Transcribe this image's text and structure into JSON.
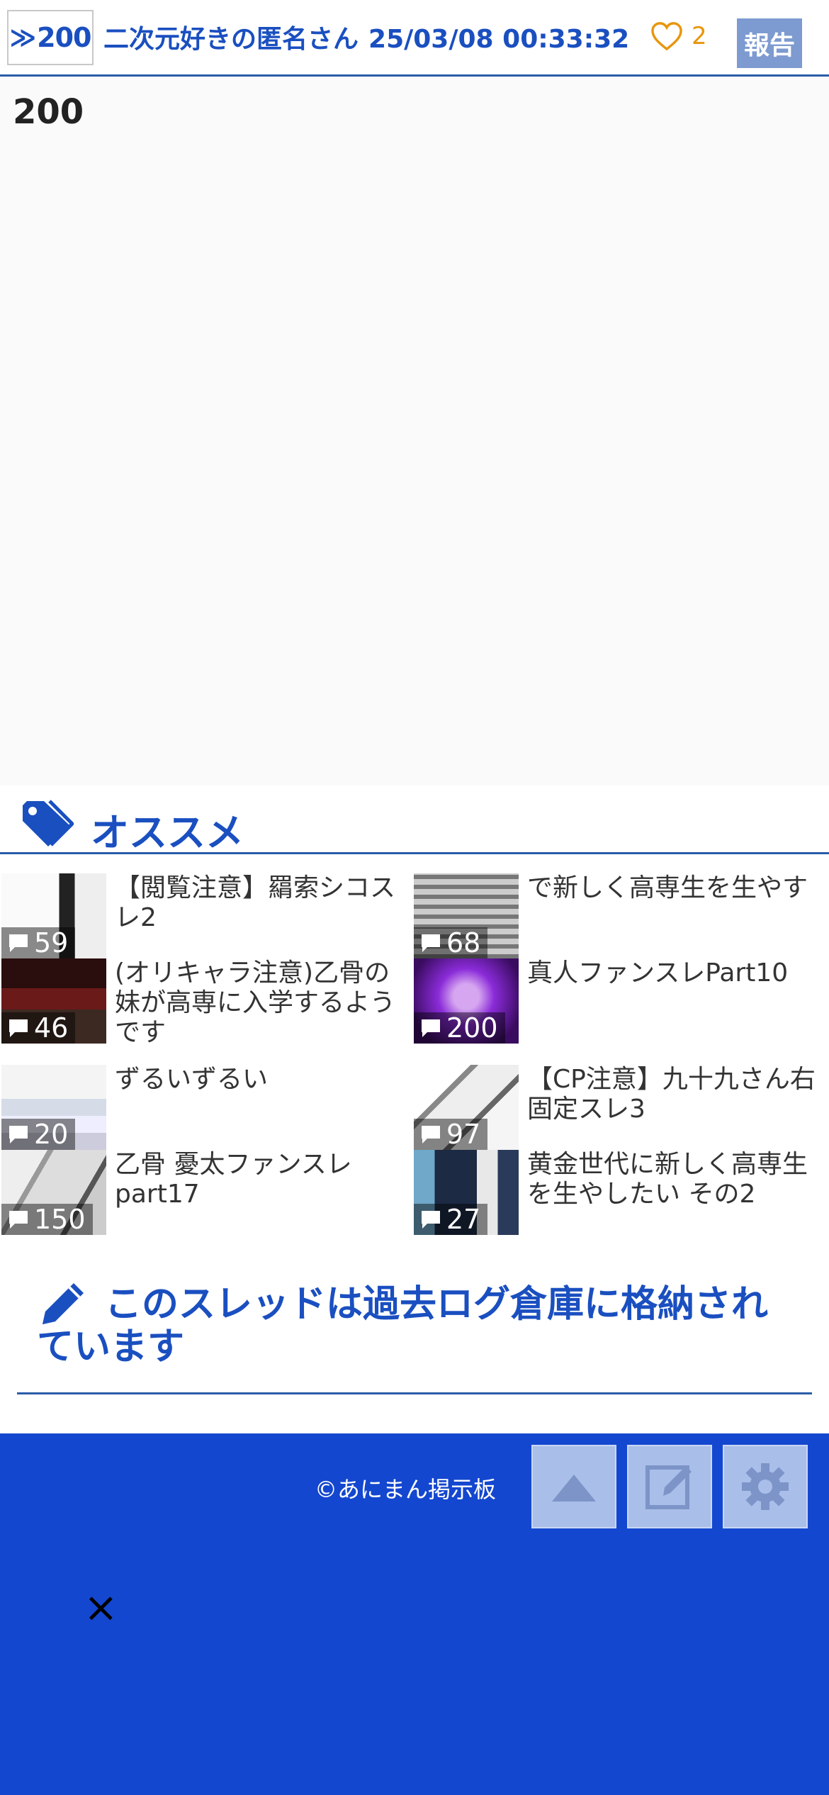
{
  "post": {
    "resno_label": "200",
    "poster_name": "二次元好きの匿名さん",
    "timestamp": "25/03/08 00:33:32",
    "likes": "2",
    "report_label": "報告",
    "body": "200"
  },
  "recommend": {
    "title": "オススメ",
    "items": [
      {
        "title": "【閲覧注意】羂索シコスレ2",
        "count": "59"
      },
      {
        "title": "で新しく高専生を生やす",
        "count": "68"
      },
      {
        "title": "(オリキャラ注意)乙骨の妹が高専に入学するようです",
        "count": "46"
      },
      {
        "title": "真人ファンスレPart10",
        "count": "200"
      },
      {
        "title": "ずるいずるい",
        "count": "20"
      },
      {
        "title": "【CP注意】九十九さん右固定スレ3",
        "count": "97"
      },
      {
        "title": "乙骨 憂太ファンスレpart17",
        "count": "150"
      },
      {
        "title": "黄金世代に新しく高専生を生やしたい その2",
        "count": "27"
      }
    ]
  },
  "archive_notice": "このスレッドは過去ログ倉庫に格納されています",
  "footer": {
    "copyright": "©あにまん掲示板"
  },
  "close_label": "×",
  "colors": {
    "accent": "#1a4fc0",
    "footer_bg": "#1447cf",
    "like": "#e8960c",
    "report_bg": "#7d9bd0"
  }
}
